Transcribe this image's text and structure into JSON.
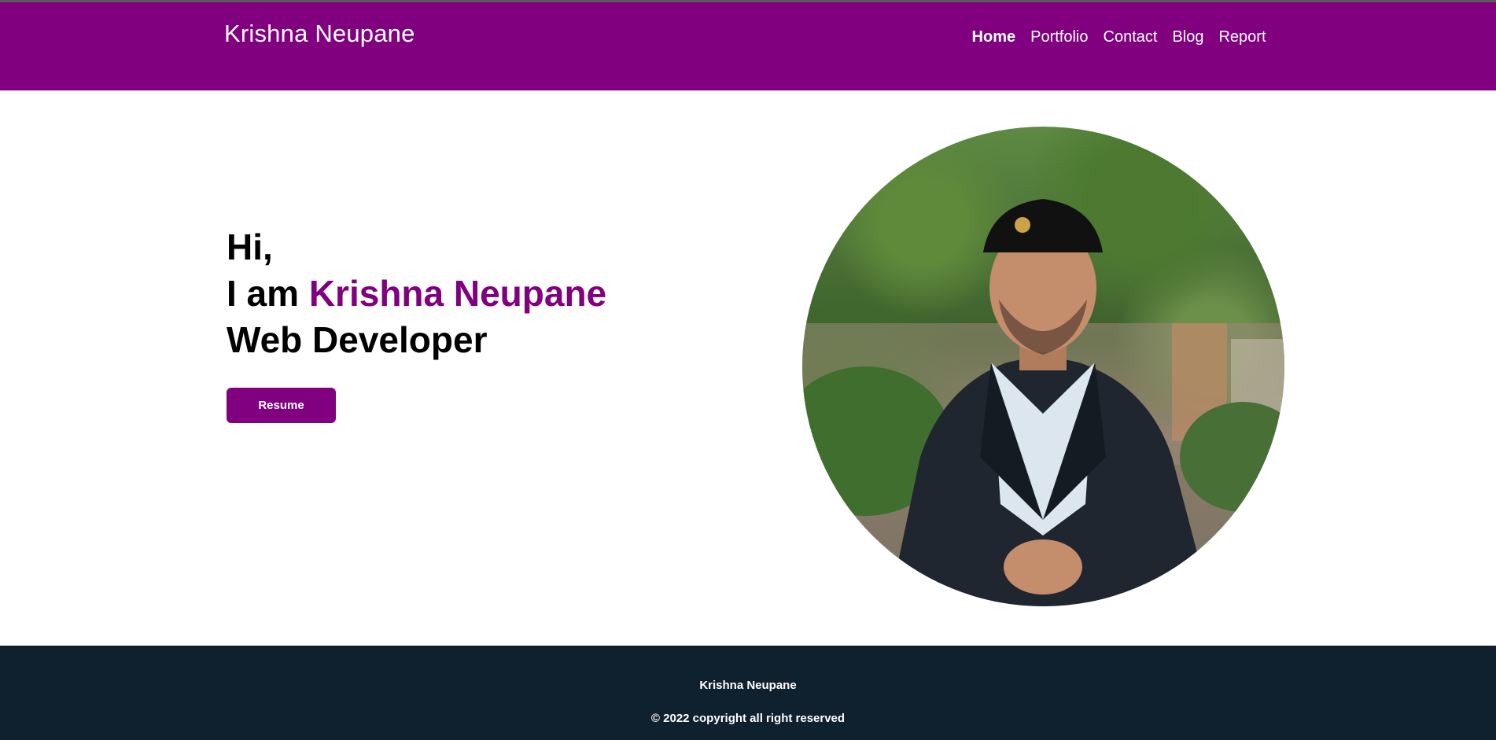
{
  "header": {
    "brand": "Krishna Neupane",
    "nav": [
      {
        "label": "Home",
        "active": true
      },
      {
        "label": "Portfolio",
        "active": false
      },
      {
        "label": "Contact",
        "active": false
      },
      {
        "label": "Blog",
        "active": false
      },
      {
        "label": "Report",
        "active": false
      }
    ]
  },
  "hero": {
    "greeting": "Hi,",
    "intro": "I am ",
    "name": "Krishna Neupane",
    "role": "Web Developer",
    "button_label": "Resume"
  },
  "footer": {
    "name": "Krishna Neupane",
    "copyright": "© 2022 copyright all right reserved"
  },
  "colors": {
    "brand": "#800080",
    "footer_bg": "#0f212f",
    "text": "#000000"
  }
}
